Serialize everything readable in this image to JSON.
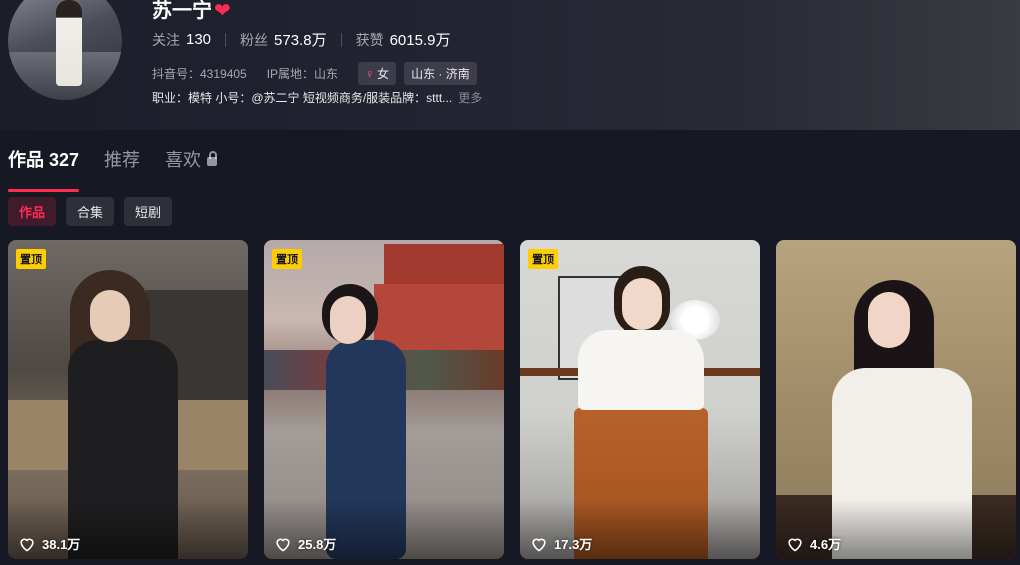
{
  "profile": {
    "name": "苏一宁",
    "stats": [
      {
        "label": "关注",
        "value": "130"
      },
      {
        "label": "粉丝",
        "value": "573.8万"
      },
      {
        "label": "获赞",
        "value": "6015.9万"
      }
    ],
    "douyin_id": "抖音号：4319405",
    "ip_location": "IP属地：山东",
    "gender_tag": "女",
    "region_tag": "山东 · 济南",
    "bio": "职业：模特 小号：@苏二宁 短视频商务/服装品牌：sttt...",
    "more_label": "更多"
  },
  "tabs": [
    {
      "label": "作品 327",
      "active": true
    },
    {
      "label": "推荐",
      "active": false
    },
    {
      "label": "喜欢",
      "active": false
    }
  ],
  "chips": [
    {
      "label": "作品",
      "active": true
    },
    {
      "label": "合集",
      "active": false
    },
    {
      "label": "短剧",
      "active": false
    }
  ],
  "videos": [
    {
      "pinned_label": "置顶",
      "likes": "38.1万"
    },
    {
      "pinned_label": "置顶",
      "likes": "25.8万"
    },
    {
      "pinned_label": "置顶",
      "likes": "17.3万"
    },
    {
      "pinned_label": "",
      "likes": "4.6万"
    }
  ],
  "colors": {
    "background": "#161823",
    "accent": "#fe2c55",
    "pin": "#fece00"
  }
}
